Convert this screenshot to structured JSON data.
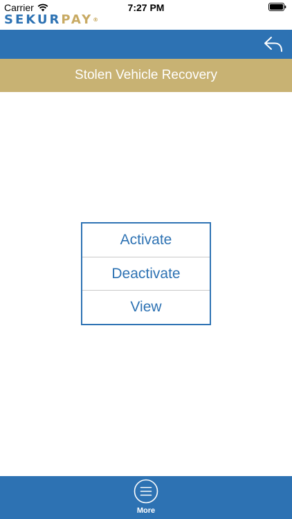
{
  "status_bar": {
    "carrier": "Carrier",
    "time": "7:27 PM"
  },
  "logo": {
    "part_a": "SEKUR",
    "part_b": "PAY",
    "registered": "®"
  },
  "header": {
    "back_icon": "reply-arrow-icon",
    "title": "Stolen Vehicle Recovery"
  },
  "menu": {
    "items": [
      {
        "label": "Activate"
      },
      {
        "label": "Deactivate"
      },
      {
        "label": "View"
      }
    ]
  },
  "bottom_bar": {
    "more_icon": "menu-lines-circle-icon",
    "more_label": "More"
  },
  "colors": {
    "primary_blue": "#2d72b3",
    "gold": "#c8b273",
    "white": "#ffffff"
  }
}
